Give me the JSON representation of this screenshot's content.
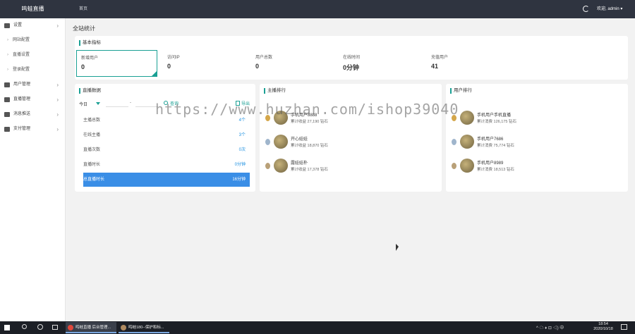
{
  "brand": "鸣蛙直播",
  "top_nav": {
    "home": "首页",
    "welcome": "欢迎, admin ▾"
  },
  "sidebar": {
    "items": [
      {
        "label": "设置",
        "icon": "gear-icon"
      },
      {
        "label": "网站配置",
        "sub": true
      },
      {
        "label": "直播设置",
        "sub": true
      },
      {
        "label": "登录配置",
        "sub": true
      },
      {
        "label": "用户管理",
        "icon": "users-icon"
      },
      {
        "label": "直播管理",
        "icon": "monitor-icon"
      },
      {
        "label": "消息推送",
        "icon": "bell-icon"
      },
      {
        "label": "支付管理",
        "icon": "monitor-icon"
      }
    ]
  },
  "page_title": "全站统计",
  "basic": {
    "title": "基本指标",
    "stats": [
      {
        "label": "新增用户",
        "value": "0"
      },
      {
        "label": "访问IP",
        "value": "0"
      },
      {
        "label": "用户总数",
        "value": "0"
      },
      {
        "label": "在线时间",
        "value": "0分钟"
      },
      {
        "label": "充值用户",
        "value": "41"
      }
    ]
  },
  "live": {
    "title": "直播数据",
    "filter_label": "今日",
    "date_sep": "-",
    "search_label": "查询",
    "export_label": "导出",
    "rows": [
      {
        "label": "主播总数",
        "value": "4个"
      },
      {
        "label": "在线主播",
        "value": "3个"
      },
      {
        "label": "直播次数",
        "value": "0次"
      },
      {
        "label": "直播时长",
        "value": "0分钟"
      },
      {
        "label": "总直播时长",
        "value": "16分钟"
      }
    ]
  },
  "anchor_rank": {
    "title": "主播排行",
    "rows": [
      {
        "name": "手机用户8888",
        "sub": "累计收益 27,190 钻石"
      },
      {
        "name": "开心娃娃",
        "sub": "累计收益 18,870 钻石"
      },
      {
        "name": "露娃娃朴",
        "sub": "累计收益 17,378 钻石"
      }
    ]
  },
  "user_rank": {
    "title": "用户排行",
    "rows": [
      {
        "name": "手机用户手机直播",
        "sub": "累计消费 126,175 钻石"
      },
      {
        "name": "手机用户7686",
        "sub": "累计消费 75,774 钻石"
      },
      {
        "name": "手机用户8989",
        "sub": "累计消费 18,513 钻石"
      }
    ]
  },
  "watermark": "https://www.huzhan.com/ishop39040",
  "taskbar": {
    "app1": "鸣蛙直播 后台管理...",
    "app2": "鸣蛙180--保护和标...",
    "tray": "^ ☁ ♦ ⊡ ◁) 中",
    "time": "18:54",
    "date": "2020/10/18"
  }
}
